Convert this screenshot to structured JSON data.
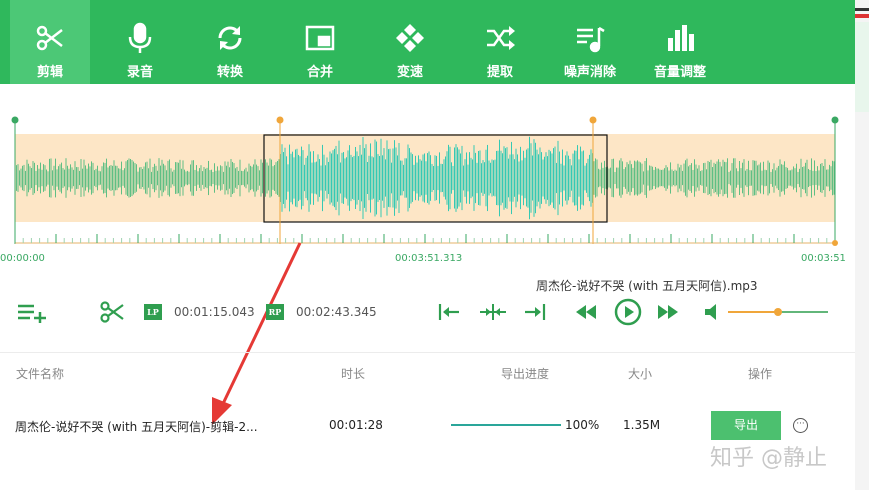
{
  "toolbar": {
    "items": [
      {
        "label": "剪辑",
        "icon": "scissors-icon"
      },
      {
        "label": "录音",
        "icon": "microphone-icon"
      },
      {
        "label": "转换",
        "icon": "refresh-icon"
      },
      {
        "label": "合并",
        "icon": "merge-icon"
      },
      {
        "label": "变速",
        "icon": "speed-icon"
      },
      {
        "label": "提取",
        "icon": "shuffle-icon"
      },
      {
        "label": "噪声消除",
        "icon": "noise-icon"
      },
      {
        "label": "音量调整",
        "icon": "volume-bars-icon"
      }
    ],
    "active": "剪辑"
  },
  "waveform": {
    "time_start": "00:00:00",
    "time_mid": "00:03:51.313",
    "time_end": "00:03:51",
    "colors": {
      "outer": "#5fbf84",
      "selected": "#35c9b4",
      "bg": "#fde6c6",
      "marker": "#f0a63a"
    }
  },
  "player": {
    "file_name": "周杰伦-说好不哭 (with 五月天阿信).mp3",
    "lp_badge": "LP",
    "lp_time": "00:01:15.043",
    "rp_badge": "RP",
    "rp_time": "00:02:43.345",
    "volume_level": 0.5
  },
  "table": {
    "headers": {
      "name": "文件名称",
      "duration": "时长",
      "progress": "导出进度",
      "size": "大小",
      "action": "操作"
    },
    "rows": [
      {
        "name": "周杰伦-说好不哭 (with 五月天阿信)-剪辑-2...",
        "duration": "00:01:28",
        "progress": "100%",
        "progress_value": 100,
        "size": "1.35M",
        "action": "导出",
        "more": "···"
      }
    ]
  },
  "watermark": "知乎 @静止"
}
